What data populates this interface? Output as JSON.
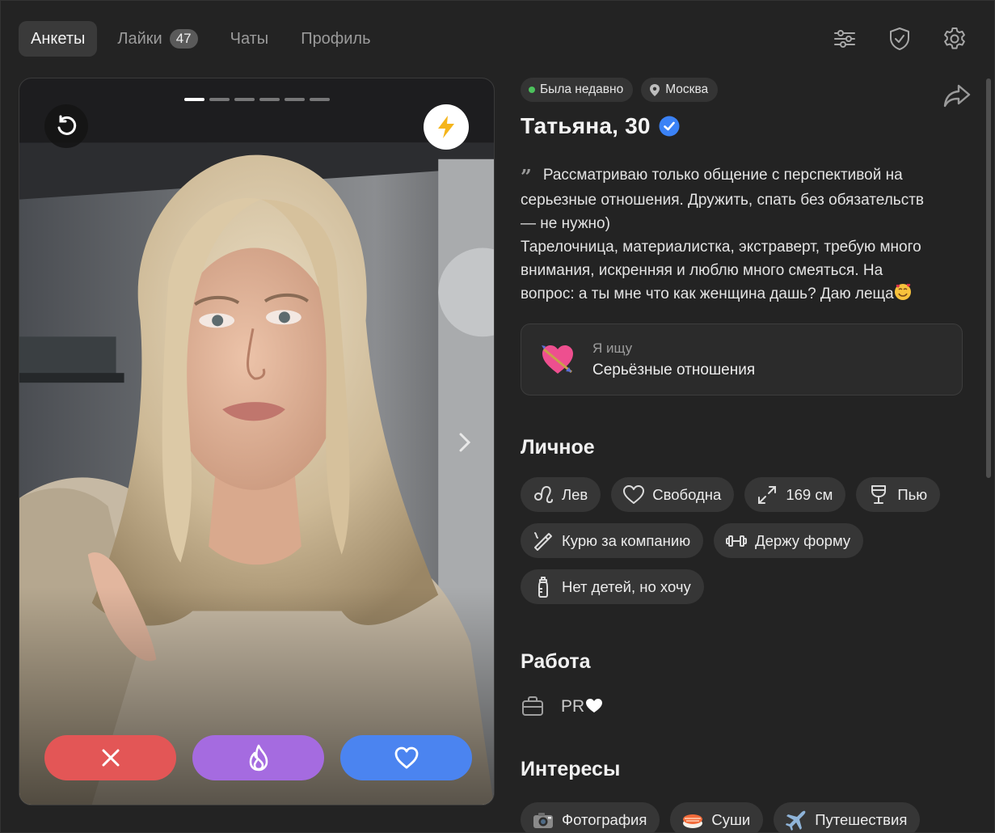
{
  "nav": {
    "tabs": [
      {
        "label": "Анкеты"
      },
      {
        "label": "Лайки",
        "badge": "47"
      },
      {
        "label": "Чаты"
      },
      {
        "label": "Профиль"
      }
    ],
    "icons": [
      "filters-icon",
      "shield-check-icon",
      "settings-icon"
    ]
  },
  "photo": {
    "count": 6,
    "active_index": 0
  },
  "profile": {
    "status": "Была недавно",
    "city": "Москва",
    "name_age": "Татьяна, 30",
    "verified": true,
    "bio_lines": [
      "Рассматриваю только общение с перспективой на",
      "серьезные отношения. Дружить, спать без обязательств",
      "— не нужно)",
      "Тарелочница, материалистка, экстраверт, требую много",
      "внимания, искренняя и люблю много смеяться. На",
      "вопрос: а ты мне что как женщина дашь? Даю леща"
    ],
    "seeking_label": "Я ищу",
    "seeking_value": "Серьёзные отношения"
  },
  "personal": {
    "title": "Личное",
    "chips": [
      {
        "icon": "leo-icon",
        "label": "Лев"
      },
      {
        "icon": "heart-outline-icon",
        "label": "Свободна"
      },
      {
        "icon": "height-icon",
        "label": "169 см"
      },
      {
        "icon": "wine-glass-icon",
        "label": "Пью"
      },
      {
        "icon": "cigarette-icon",
        "label": "Курю за компанию"
      },
      {
        "icon": "dumbbell-icon",
        "label": "Держу форму"
      },
      {
        "icon": "baby-bottle-icon",
        "label": "Нет детей, но хочу"
      }
    ]
  },
  "work": {
    "title": "Работа",
    "value": "PR"
  },
  "interests": {
    "title": "Интересы",
    "chips": [
      {
        "emoji": "📷",
        "label": "Фотография"
      },
      {
        "emoji": "🍣",
        "label": "Суши"
      },
      {
        "emoji": "✈️",
        "label": "Путешествия"
      }
    ]
  },
  "colors": {
    "background": "#232323",
    "chip": "#363636",
    "dislike": "#e35656",
    "superlike": "#a56be0",
    "like": "#4b84f0",
    "verified": "#3b82f6",
    "online": "#4cc25c",
    "boost": "#f5b51b"
  }
}
